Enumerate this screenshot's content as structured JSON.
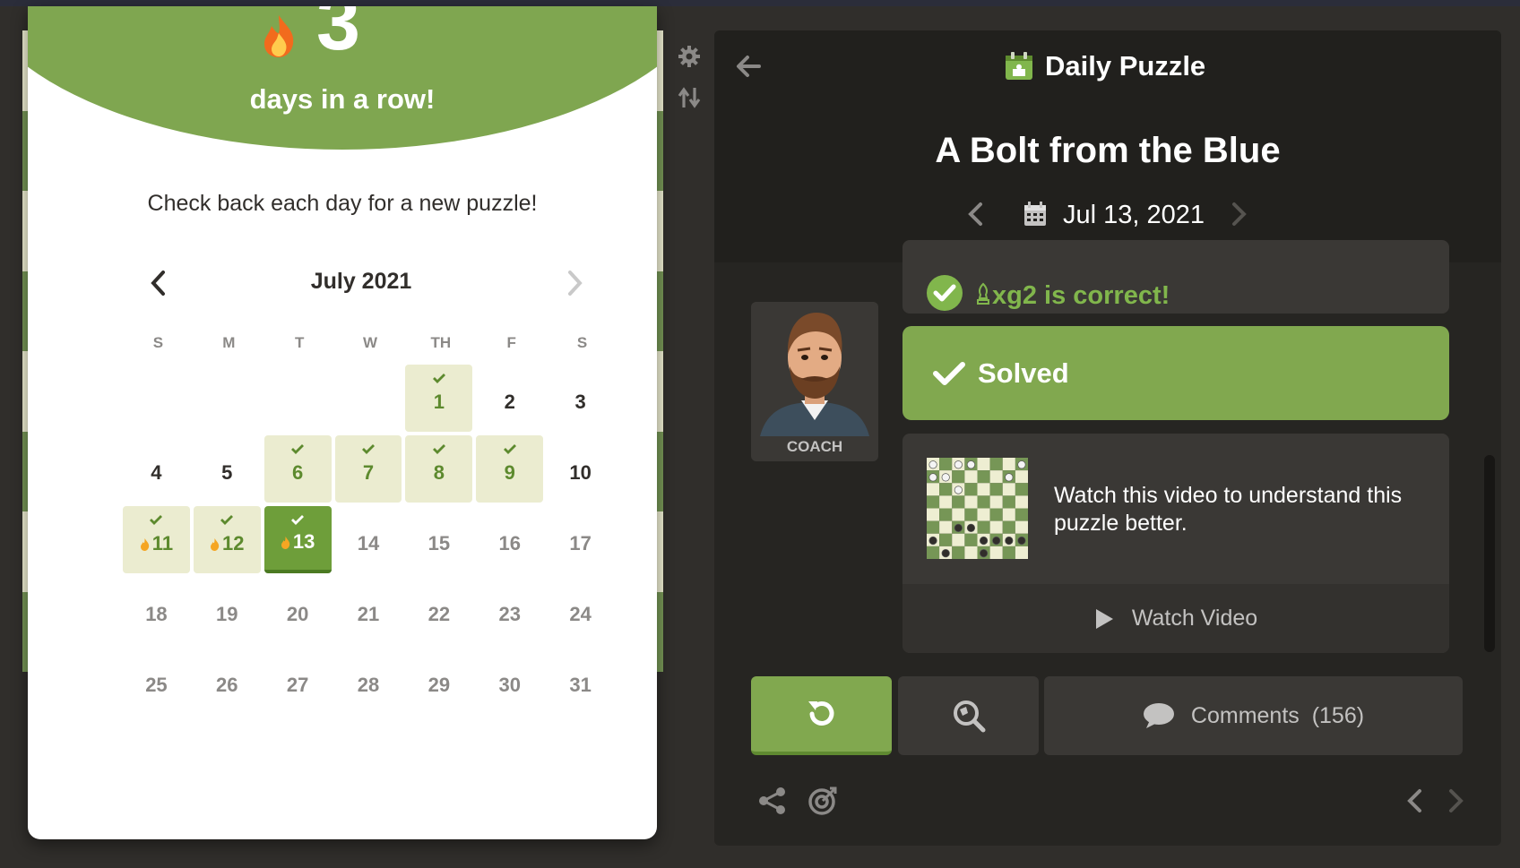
{
  "modal": {
    "streak_count": "3",
    "streak_label": "days in a row!",
    "check_back": "Check back each day for a new puzzle!",
    "calendar": {
      "month": "July 2021",
      "weekdays": [
        "S",
        "M",
        "T",
        "W",
        "TH",
        "F",
        "S"
      ],
      "weeks": [
        [
          {
            "d": "",
            "s": "empty"
          },
          {
            "d": "",
            "s": "empty"
          },
          {
            "d": "",
            "s": "empty"
          },
          {
            "d": "",
            "s": "empty"
          },
          {
            "d": "1",
            "s": "solved"
          },
          {
            "d": "2",
            "s": "past"
          },
          {
            "d": "3",
            "s": "past"
          }
        ],
        [
          {
            "d": "4",
            "s": "past"
          },
          {
            "d": "5",
            "s": "past"
          },
          {
            "d": "6",
            "s": "solved"
          },
          {
            "d": "7",
            "s": "solved"
          },
          {
            "d": "8",
            "s": "solved"
          },
          {
            "d": "9",
            "s": "solved"
          },
          {
            "d": "10",
            "s": "past"
          }
        ],
        [
          {
            "d": "11",
            "s": "streak"
          },
          {
            "d": "12",
            "s": "streak"
          },
          {
            "d": "13",
            "s": "today"
          },
          {
            "d": "14",
            "s": "future"
          },
          {
            "d": "15",
            "s": "future"
          },
          {
            "d": "16",
            "s": "future"
          },
          {
            "d": "17",
            "s": "future"
          }
        ],
        [
          {
            "d": "18",
            "s": "future"
          },
          {
            "d": "19",
            "s": "future"
          },
          {
            "d": "20",
            "s": "future"
          },
          {
            "d": "21",
            "s": "future"
          },
          {
            "d": "22",
            "s": "future"
          },
          {
            "d": "23",
            "s": "future"
          },
          {
            "d": "24",
            "s": "future"
          }
        ],
        [
          {
            "d": "25",
            "s": "future"
          },
          {
            "d": "26",
            "s": "future"
          },
          {
            "d": "27",
            "s": "future"
          },
          {
            "d": "28",
            "s": "future"
          },
          {
            "d": "29",
            "s": "future"
          },
          {
            "d": "30",
            "s": "future"
          },
          {
            "d": "31",
            "s": "future"
          }
        ]
      ]
    }
  },
  "panel": {
    "header_title": "Daily Puzzle",
    "puzzle_title": "A Bolt from the Blue",
    "date": "Jul 13, 2021",
    "correct_move": "xg2",
    "correct_suffix": " is correct!",
    "coach_label": "COACH",
    "solved_label": "Solved",
    "video_text": "Watch this video to understand this puzzle better.",
    "watch_label": "Watch Video",
    "comments_label": "Comments",
    "comments_count": "(156)"
  },
  "colors": {
    "accent_green": "#81a84f",
    "streak_green": "#7fa650",
    "solved_day_bg": "#ebecd0",
    "panel_bg": "#262522"
  },
  "icons": [
    "fire-icon",
    "chevron-left-icon",
    "chevron-right-icon",
    "check-icon",
    "gear-icon",
    "flip-board-icon",
    "arrow-left-icon",
    "puzzle-icon",
    "calendar-icon",
    "play-icon",
    "retry-icon",
    "hint-zoom-icon",
    "comment-icon",
    "share-icon",
    "target-icon",
    "bishop-icon"
  ]
}
